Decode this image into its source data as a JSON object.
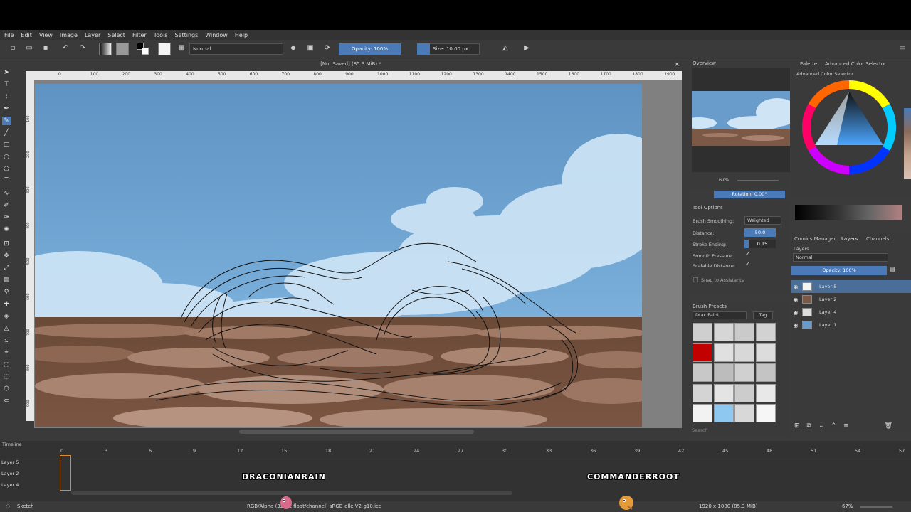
{
  "menu": [
    "File",
    "Edit",
    "View",
    "Image",
    "Layer",
    "Select",
    "Filter",
    "Tools",
    "Settings",
    "Window",
    "Help"
  ],
  "toolbar": {
    "blend_mode": "Normal",
    "opacity": "Opacity: 100%",
    "size": "Size: 10.00 px"
  },
  "document": {
    "title": "[Not Saved]  (85.3 MiB) *"
  },
  "ruler": [
    "0",
    "100",
    "200",
    "300",
    "400",
    "500",
    "600",
    "700",
    "800",
    "900",
    "1000",
    "1100",
    "1200",
    "1300",
    "1400",
    "1500",
    "1600",
    "1700",
    "1800",
    "1900"
  ],
  "ruler_left": [
    "100",
    "200",
    "300",
    "400",
    "500",
    "600",
    "700",
    "800",
    "900"
  ],
  "overview": {
    "title": "Overview",
    "zoom": "67%",
    "rotation": "Rotation: 0.00°"
  },
  "tool_options": {
    "title": "Tool Options",
    "brush_smoothing_label": "Brush Smoothing:",
    "brush_smoothing_value": "Weighted",
    "distance_label": "Distance:",
    "distance_value": "50.0",
    "stroke_ending_label": "Stroke Ending:",
    "stroke_ending_value": "0.15",
    "smooth_pressure_label": "Smooth Pressure:",
    "scalable_distance_label": "Scalable Distance:",
    "snap_label": "Snap to Assistants"
  },
  "brush_presets": {
    "title": "Brush Presets",
    "tag_value": "Drac Paint",
    "tag_button": "Tag",
    "search_placeholder": "Search"
  },
  "color": {
    "tab_palette": "Palette",
    "tab_advanced": "Advanced Color Selector",
    "title": "Advanced Color Selector"
  },
  "layers": {
    "tab_comics": "Comics Manager",
    "tab_layers": "Layers",
    "tab_channels": "Channels",
    "title": "Layers",
    "blend": "Normal",
    "opacity": "Opacity: 100%",
    "items": [
      {
        "name": "Layer 5",
        "selected": true
      },
      {
        "name": "Layer 2",
        "selected": false
      },
      {
        "name": "Layer 4",
        "selected": false
      },
      {
        "name": "Layer 1",
        "selected": false
      }
    ]
  },
  "timeline": {
    "title": "Timeline",
    "frames": [
      "0",
      "3",
      "6",
      "9",
      "12",
      "15",
      "18",
      "21",
      "24",
      "27",
      "30",
      "33",
      "36",
      "39",
      "42",
      "45",
      "48",
      "51",
      "54",
      "57"
    ],
    "layers": [
      "Layer 5",
      "Layer 2",
      "Layer 4"
    ]
  },
  "stream": {
    "left_name": "DRACONIANRAIN",
    "right_name": "COMMANDERROOT"
  },
  "status": {
    "brush": "Sketch",
    "color_model": "RGB/Alpha (32-bit float/channel)  sRGB-elle-V2-g10.icc",
    "dimensions": "1920 x 1080 (85.3 MiB)",
    "zoom": "67%"
  }
}
